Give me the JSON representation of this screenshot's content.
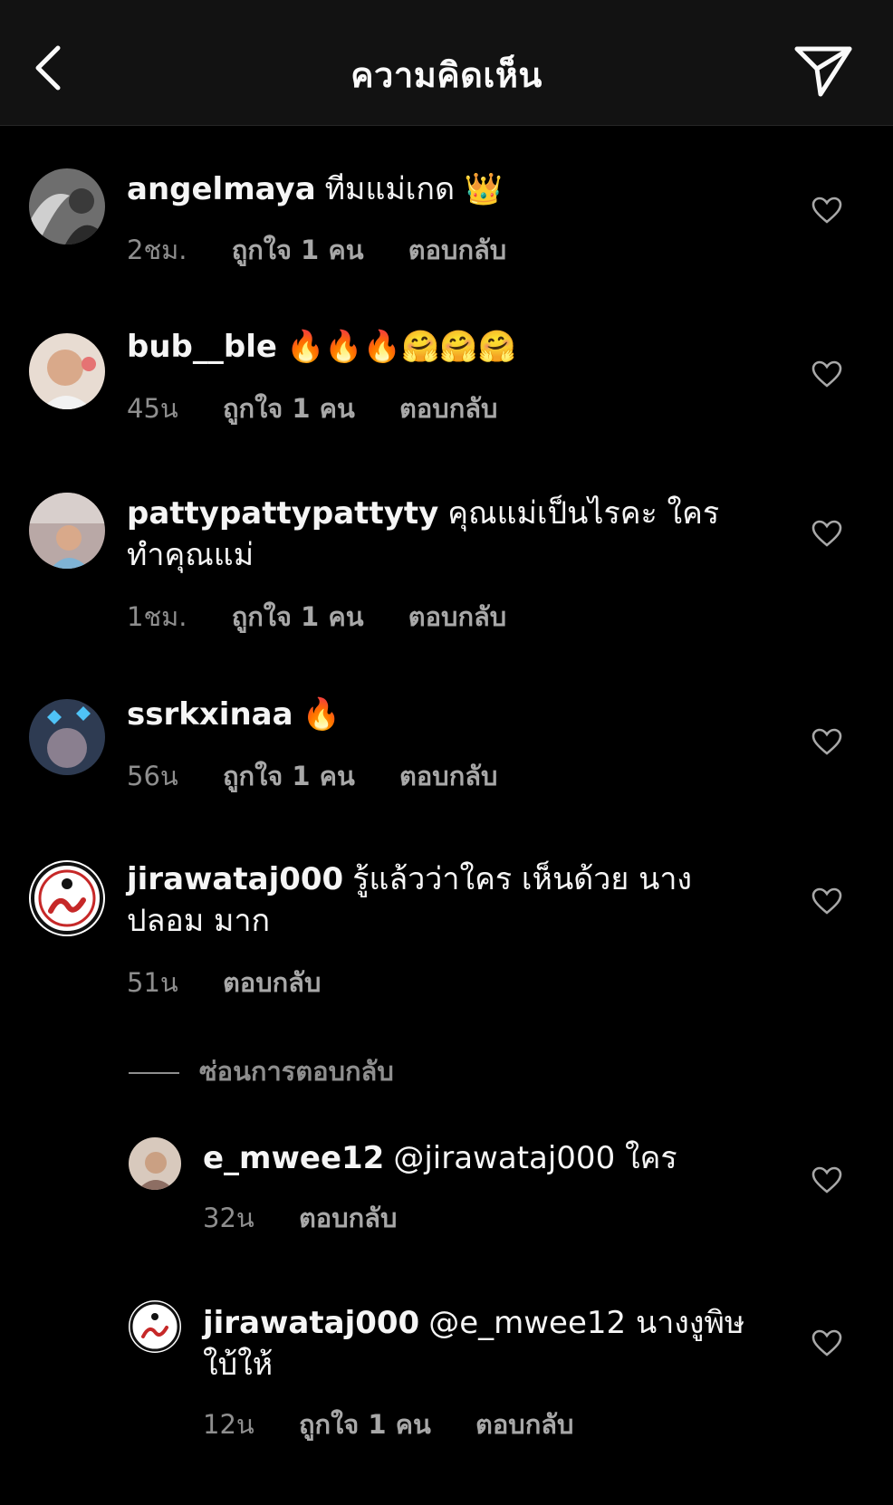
{
  "header": {
    "title": "ความคิดเห็น"
  },
  "comments": [
    {
      "username": "angelmaya",
      "text": "ทีมแม่เกด 👑",
      "time": "2ชม.",
      "likes": "ถูกใจ 1 คน",
      "reply": "ตอบกลับ"
    },
    {
      "username": "bub__ble",
      "text": "🔥🔥🔥🤗🤗🤗",
      "time": "45น",
      "likes": "ถูกใจ 1 คน",
      "reply": "ตอบกลับ"
    },
    {
      "username": "pattypattypattyty",
      "text": "คุณแม่เป็นไรคะ ใคร ทำคุณแม่",
      "time": "1ชม.",
      "likes": "ถูกใจ 1 คน",
      "reply": "ตอบกลับ"
    },
    {
      "username": "ssrkxinaa",
      "text": "🔥",
      "time": "56น",
      "likes": "ถูกใจ 1 คน",
      "reply": "ตอบกลับ"
    },
    {
      "username": "jirawataj000",
      "text": "รู้แล้วว่าใคร เห็นด้วย นางปลอม มาก",
      "time": "51น",
      "reply": "ตอบกลับ"
    }
  ],
  "hide_replies": "ซ่อนการตอบกลับ",
  "replies": [
    {
      "username": "e_mwee12",
      "text": "@jirawataj000 ใคร",
      "time": "32น",
      "reply": "ตอบกลับ"
    },
    {
      "username": "jirawataj000",
      "text": "@e_mwee12 นางงูพิษ ใบ้ให้",
      "time": "12น",
      "likes": "ถูกใจ 1 คน",
      "reply": "ตอบกลับ"
    }
  ],
  "colors": {
    "background": "#000000",
    "header_bg": "#121212",
    "primary_text": "#f5f5f5",
    "secondary_text": "#8e8e8e"
  }
}
